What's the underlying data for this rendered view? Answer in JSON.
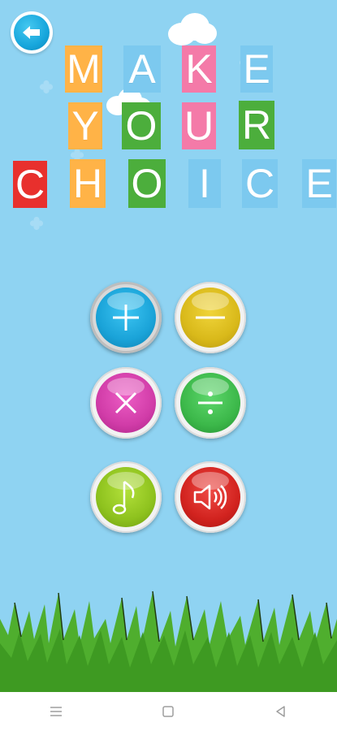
{
  "title": {
    "rows": [
      {
        "word": "MAKE",
        "letters": [
          "M",
          "A",
          "K",
          "E"
        ],
        "colors": [
          "#ffb347",
          "#7cc9ef",
          "#f47aa8",
          "#7cc9ef"
        ]
      },
      {
        "word": "YOUR",
        "letters": [
          "Y",
          "O",
          "U",
          "R"
        ],
        "colors": [
          "#ffb347",
          "#4cae3c",
          "#f47aa8",
          "#4cae3c"
        ]
      },
      {
        "word": "CHOICE",
        "letters": [
          "C",
          "H",
          "O",
          "I",
          "C",
          "E"
        ],
        "colors": [
          "#e8302d",
          "#ffb347",
          "#4cae3c",
          "#7cc9ef",
          "#7cc9ef",
          "#7cc9ef"
        ]
      }
    ]
  },
  "buttons": {
    "back": {
      "icon": "back-arrow-icon"
    },
    "plus": {
      "icon": "plus-icon",
      "color": "#1aa3d8"
    },
    "minus": {
      "icon": "minus-icon",
      "color": "#d9b91a"
    },
    "multiply": {
      "icon": "multiply-icon",
      "color": "#d13ca8"
    },
    "divide": {
      "icon": "divide-icon",
      "color": "#3cb84a"
    },
    "music": {
      "icon": "music-note-icon",
      "color": "#8ec21e"
    },
    "sound": {
      "icon": "speaker-icon",
      "color": "#d2231f"
    }
  },
  "navbar": {
    "menu": {
      "icon": "menu-icon"
    },
    "home": {
      "icon": "home-square-icon"
    },
    "back": {
      "icon": "back-triangle-icon"
    }
  }
}
